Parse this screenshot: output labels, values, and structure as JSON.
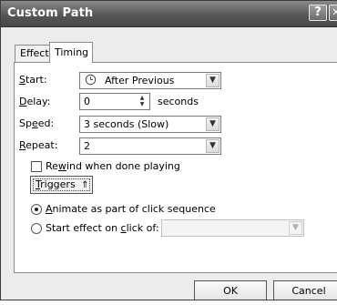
{
  "dialog": {
    "title": "Custom Path",
    "help_button": "?",
    "close_button": "X"
  },
  "tabs": [
    {
      "label": "Effect",
      "selected": false
    },
    {
      "label": "Timing",
      "selected": true
    }
  ],
  "timing": {
    "start_label": "Start:",
    "start_value": "After Previous",
    "delay_label": "Delay:",
    "delay_value": "0",
    "delay_units": "seconds",
    "speed_label": "Speed:",
    "speed_value": "3 seconds (Slow)",
    "repeat_label": "Repeat:",
    "repeat_value": "2",
    "rewind_label": "Rewind when done playing",
    "rewind_checked": false
  },
  "triggers": {
    "button_label": "Triggers",
    "animate_option": "Animate as part of click sequence",
    "animate_selected": true,
    "start_on_click_option": "Start effect on click of:",
    "start_on_click_selected": false,
    "click_target_value": ""
  },
  "footer": {
    "ok_label": "OK",
    "cancel_label": "Cancel"
  },
  "icons": {
    "start_icon": "clock-icon",
    "dropdown": "chevron-down-icon",
    "spinner": "spin-arrows-icon",
    "triggers_toggle": "double-chevron-up-icon"
  }
}
